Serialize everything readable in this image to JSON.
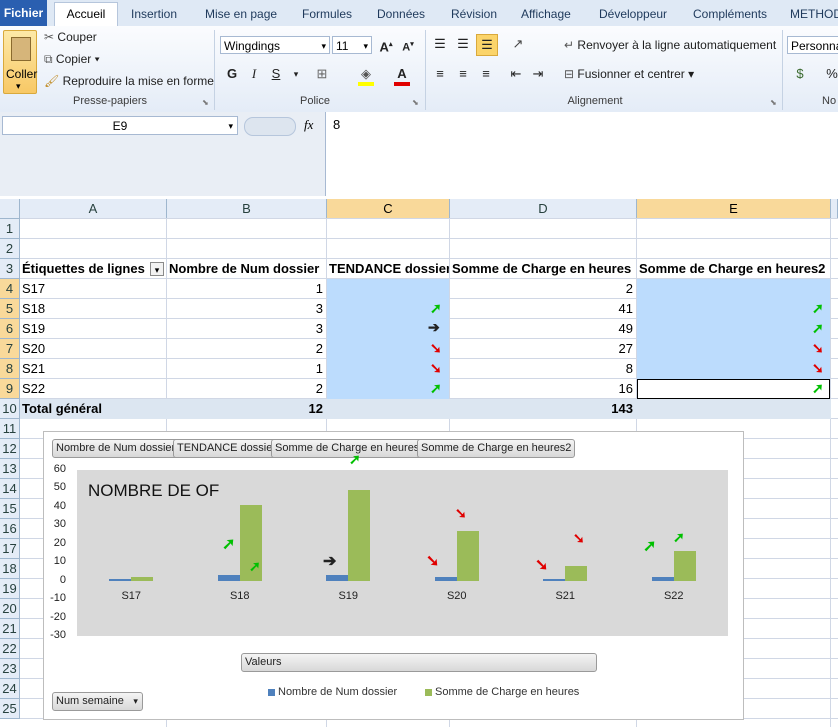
{
  "tabs": {
    "file": "Fichier",
    "items": [
      "Accueil",
      "Insertion",
      "Mise en page",
      "Formules",
      "Données",
      "Révision",
      "Affichage",
      "Développeur",
      "Compléments",
      "METHOD"
    ]
  },
  "ribbon": {
    "paste": "Coller",
    "cut": "Couper",
    "copy": "Copier",
    "format_painter": "Reproduire la mise en forme",
    "clipboard_group": "Presse-papiers",
    "font_name": "Wingdings",
    "font_size": "11",
    "font_group": "Police",
    "wrap_text": "Renvoyer à la ligne automatiquement",
    "merge_center": "Fusionner et centrer",
    "alignment_group": "Alignement",
    "number_format": "Personna",
    "number_group": "No",
    "percent": "%"
  },
  "formula_bar": {
    "name_box": "E9",
    "fx": "fx",
    "value": "8"
  },
  "grid": {
    "columns": [
      "A",
      "B",
      "C",
      "D",
      "E"
    ],
    "rows": [
      "1",
      "2",
      "3",
      "4",
      "5",
      "6",
      "7",
      "8",
      "9",
      "10",
      "11",
      "12",
      "13",
      "14",
      "15",
      "16",
      "17",
      "18",
      "19",
      "20",
      "21",
      "22",
      "23",
      "24",
      "25"
    ],
    "headers": [
      "Étiquettes de lignes",
      "Nombre de Num dossier",
      "TENDANCE dossier",
      "Somme de Charge en heures",
      "Somme de Charge en heures2"
    ],
    "data": [
      {
        "label": "S17",
        "count": "1",
        "charge": "2"
      },
      {
        "label": "S18",
        "count": "3",
        "charge": "41"
      },
      {
        "label": "S19",
        "count": "3",
        "charge": "49"
      },
      {
        "label": "S20",
        "count": "2",
        "charge": "27"
      },
      {
        "label": "S21",
        "count": "1",
        "charge": "8"
      },
      {
        "label": "S22",
        "count": "2",
        "charge": "16"
      }
    ],
    "total_label": "Total général",
    "total_count": "12",
    "total_charge": "143"
  },
  "chart_ui": {
    "field_buttons": [
      "Nombre de Num dossier",
      "TENDANCE dossier",
      "Somme de Charge en heures",
      "Somme de Charge en heures2"
    ],
    "values_button": "Valeurs",
    "axis_button": "Num semaine",
    "series_colors": [
      "#4f81bd",
      "#9bbb59"
    ]
  },
  "chart_data": {
    "type": "bar",
    "title": "NOMBRE DE OF",
    "categories": [
      "S17",
      "S18",
      "S19",
      "S20",
      "S21",
      "S22"
    ],
    "series": [
      {
        "name": "Nombre de Num dossier",
        "values": [
          1,
          3,
          3,
          2,
          1,
          2
        ]
      },
      {
        "name": "Somme de Charge en heures",
        "values": [
          2,
          41,
          49,
          27,
          8,
          16
        ]
      }
    ],
    "ylim": [
      -30,
      60
    ],
    "yticks": [
      60,
      50,
      40,
      30,
      20,
      10,
      0,
      -10,
      -20,
      -30
    ],
    "legend_position": "bottom"
  }
}
